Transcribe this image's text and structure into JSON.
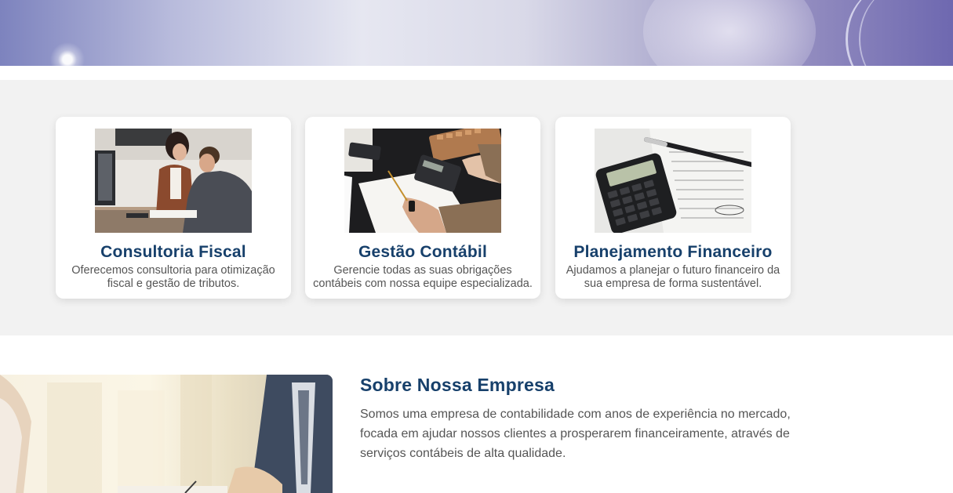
{
  "services": [
    {
      "title": "Consultoria Fiscal",
      "description": "Oferecemos consultoria para otimização fiscal e gestão de tributos.",
      "image": "business-meeting-photo"
    },
    {
      "title": "Gestão Contábil",
      "description": "Gerencie todas as suas obrigações contábeis com nossa equipe especializada.",
      "image": "calculator-desk-photo"
    },
    {
      "title": "Planejamento Financeiro",
      "description": "Ajudamos a planejar o futuro financeiro da sua empresa de forma sustentável.",
      "image": "calculator-documents-photo"
    }
  ],
  "about": {
    "title": "Sobre Nossa Empresa",
    "text": "Somos uma empresa de contabilidade com anos de experiência no mercado, focada em ajudar nossos clientes a prosperarem financeiramente, através de serviços contábeis de alta qualidade.",
    "image": "office-handshake-photo"
  },
  "colors": {
    "heading": "#17406b",
    "body_text": "#555555",
    "section_bg": "#f2f2f2",
    "card_bg": "#ffffff"
  }
}
